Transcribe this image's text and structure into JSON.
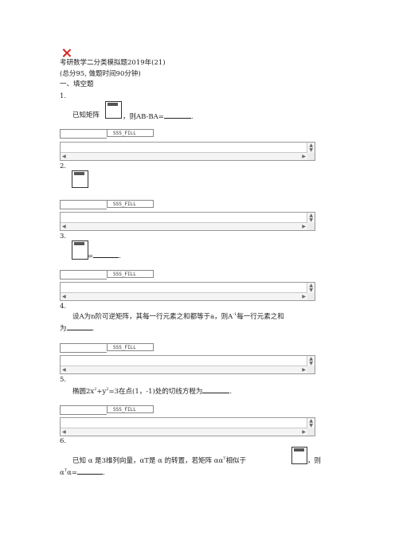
{
  "header": {
    "title": "考研数学二分类模拟题2019年(21)",
    "subtitle": "(总分95, 做题时间90分钟)",
    "section": "一、填空题"
  },
  "fill_label": "SSS_FILL",
  "questions": [
    {
      "num": "1.",
      "text_before": "已知矩阵",
      "text_after": "，则AB-BA=",
      "text_end": "."
    },
    {
      "num": "2."
    },
    {
      "num": "3.",
      "text_after": "=",
      "text_end": "."
    },
    {
      "num": "4.",
      "line1": "设A为n阶可逆矩阵，其每一行元素之和都等于a，则A",
      "line1_sup": "-1",
      "line1_end": "每一行元素之和",
      "line2": "为",
      "line2_end": "."
    },
    {
      "num": "5.",
      "t1": "椭圆2x",
      "sup1": "2",
      "t2": "+y",
      "sup2": "2",
      "t3": "=3在点(1，-1)处的切线方程为",
      "t_end": "."
    },
    {
      "num": "6.",
      "line1": "已知 α 是3维列向量，αT是 α 的转置，若矩阵 αα",
      "line1_sup": "T",
      "line1_mid": "相似于",
      "line1_end": "，则",
      "line2": "α",
      "line2_sup": "T",
      "line2_mid": "α=",
      "line2_end": "."
    }
  ]
}
